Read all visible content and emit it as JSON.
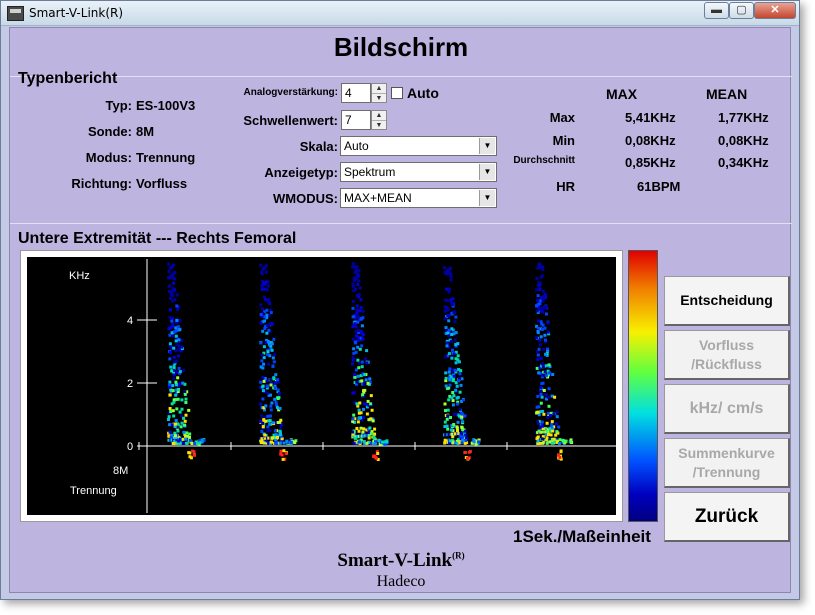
{
  "window": {
    "title": "Smart-V-Link(R)",
    "minimize_glyph": "▬",
    "maximize_glyph": "▢",
    "close_glyph": "✕"
  },
  "page_title": "Bildschirm",
  "typenbericht": {
    "heading": "Typenbericht",
    "fields": [
      {
        "label": "Typ:",
        "value": "ES-100V3"
      },
      {
        "label": "Sonde:",
        "value": "8M"
      },
      {
        "label": "Modus:",
        "value": "Trennung"
      },
      {
        "label": "Richtung:",
        "value": "Vorfluss"
      }
    ]
  },
  "controls": {
    "gain_label": "Analogverstärkung:",
    "gain_value": "4",
    "auto_label": "Auto",
    "threshold_label": "Schwellenwert:",
    "threshold_value": "7",
    "scale_label": "Skala:",
    "scale_value": "Auto",
    "display_label": "Anzeigetyp:",
    "display_value": "Spektrum",
    "wmode_label": "WMODUS:",
    "wmode_value": "MAX+MEAN",
    "spin_up": "▲",
    "spin_down": "▼",
    "dropdown_arrow": "▼"
  },
  "stats": {
    "col_max": "MAX",
    "col_mean": "MEAN",
    "rows": [
      {
        "label": "Max",
        "max": "5,41KHz",
        "mean": "1,77KHz"
      },
      {
        "label": "Min",
        "max": "0,08KHz",
        "mean": "0,08KHz"
      },
      {
        "label": "Durchschnitt",
        "max": "0,85KHz",
        "mean": "0,34KHz"
      }
    ],
    "hr_label": "HR",
    "hr_value": "61BPM"
  },
  "section_title": "Untere Extremität --- Rechts Femoral",
  "spectrum": {
    "y_unit": "KHz",
    "y_ticks": [
      "4",
      "2",
      "0"
    ],
    "probe": "8M",
    "mode": "Trennung",
    "time_unit": "1Sek./Maßeinheit",
    "beats": 5
  },
  "buttons": {
    "decision": "Entscheidung",
    "flow_line1": "Vorfluss",
    "flow_line2": "/Rückfluss",
    "units": "kHz/ cm/s",
    "sum_line1": "Summenkurve",
    "sum_line2": "/Trennung",
    "back": "Zurück"
  },
  "footer": {
    "brand": "Smart-V-Link",
    "reg": "(R)",
    "company": "Hadeco"
  },
  "colors": {
    "panel": "#bdb5e0",
    "chart_bg": "#000000"
  }
}
